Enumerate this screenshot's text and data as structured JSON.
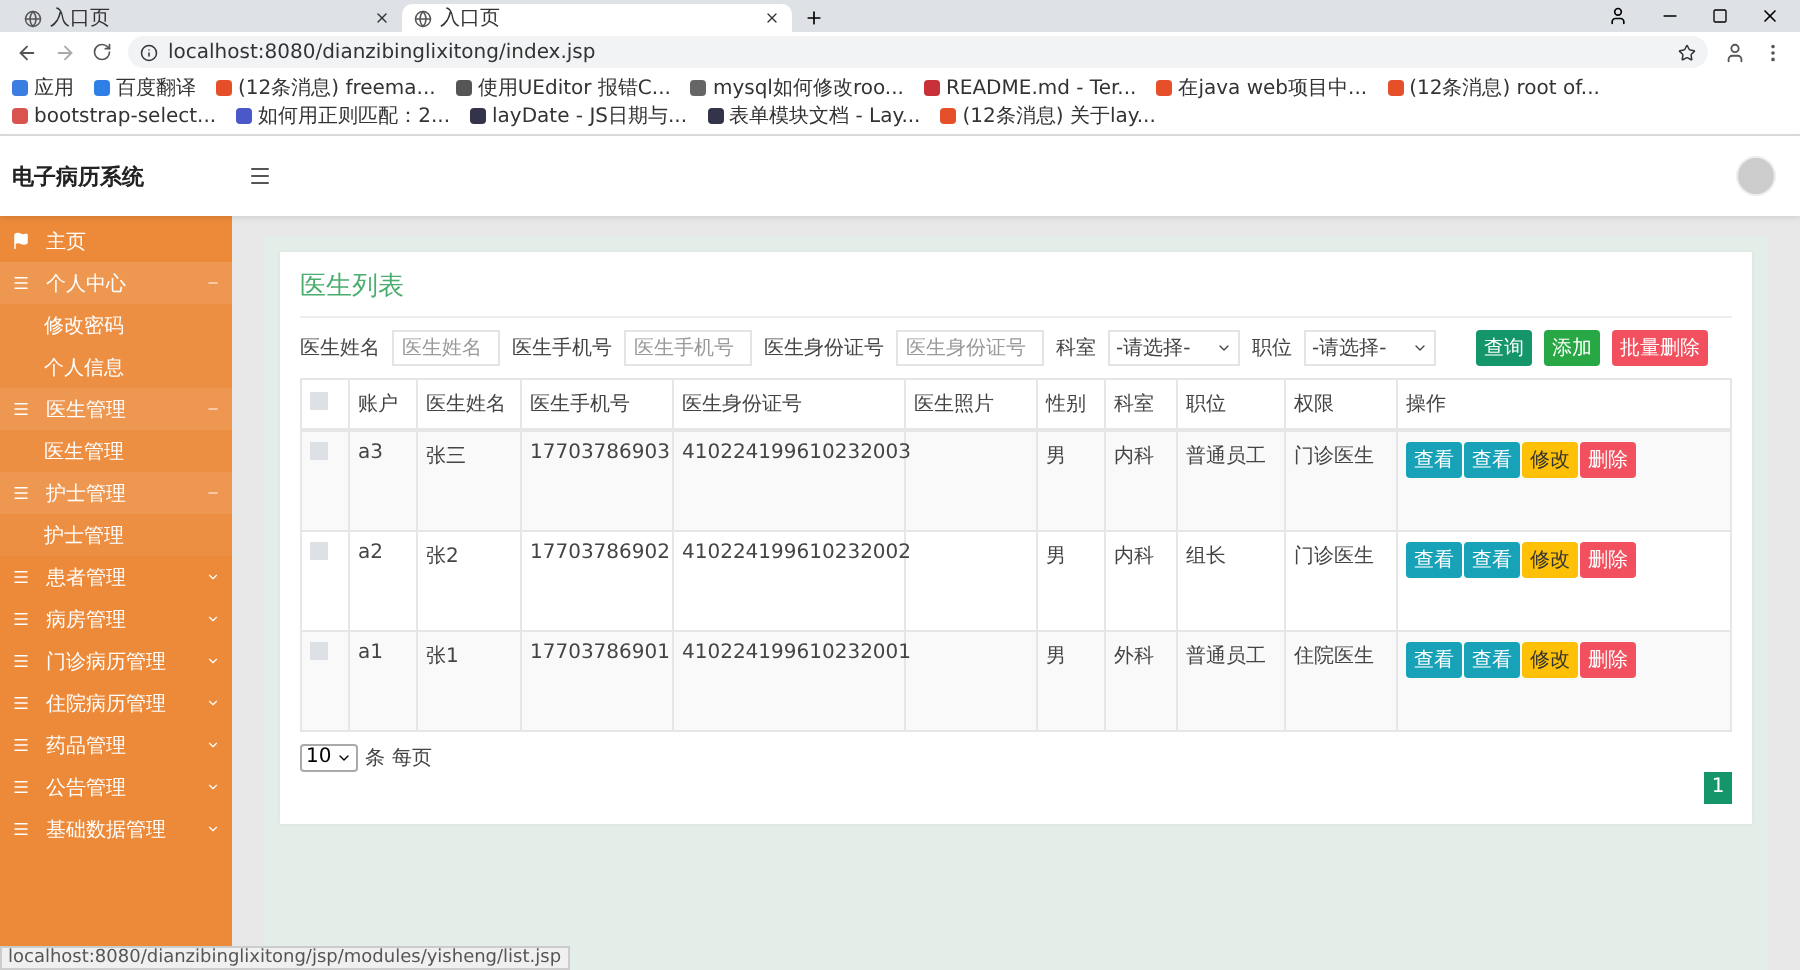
{
  "browser": {
    "tabs": [
      {
        "title": "入口页",
        "selected": false
      },
      {
        "title": "入口页",
        "selected": true
      }
    ],
    "address": "localhost:8080/dianzibinglixitong/index.jsp",
    "bookmarks": [
      {
        "label": "应用",
        "color": "#3b7de0"
      },
      {
        "label": "百度翻译",
        "color": "#2f7fe6"
      },
      {
        "label": "(12条消息) freema...",
        "color": "#e5502b"
      },
      {
        "label": "使用UEditor 报错C...",
        "color": "#555555"
      },
      {
        "label": "mysql如何修改roo...",
        "color": "#666666"
      },
      {
        "label": "README.md - Ter...",
        "color": "#c8303a"
      },
      {
        "label": "在java web项目中...",
        "color": "#e5502b"
      },
      {
        "label": "(12条消息) root of...",
        "color": "#e5502b"
      },
      {
        "label": "bootstrap-select...",
        "color": "#d9534f"
      },
      {
        "label": "如何用正则匹配：2...",
        "color": "#4a58c8"
      },
      {
        "label": "layDate - JS日期与...",
        "color": "#33334a"
      },
      {
        "label": "表单模块文档 - Lay...",
        "color": "#33334a"
      },
      {
        "label": "(12条消息) 关于lay...",
        "color": "#e5502b"
      }
    ],
    "status_url": "localhost:8080/dianzibinglixitong/jsp/modules/yisheng/list.jsp"
  },
  "app": {
    "title": "电子病历系统"
  },
  "sidebar": [
    {
      "label": "主页",
      "kind": "link"
    },
    {
      "label": "个人中心",
      "kind": "group",
      "expanded": true,
      "children": [
        {
          "label": "修改密码"
        },
        {
          "label": "个人信息"
        }
      ]
    },
    {
      "label": "医生管理",
      "kind": "group",
      "expanded": true,
      "children": [
        {
          "label": "医生管理"
        }
      ]
    },
    {
      "label": "护士管理",
      "kind": "group",
      "expanded": true,
      "children": [
        {
          "label": "护士管理"
        }
      ]
    },
    {
      "label": "患者管理",
      "kind": "group",
      "expanded": false
    },
    {
      "label": "病房管理",
      "kind": "group",
      "expanded": false
    },
    {
      "label": "门诊病历管理",
      "kind": "group",
      "expanded": false
    },
    {
      "label": "住院病历管理",
      "kind": "group",
      "expanded": false
    },
    {
      "label": "药品管理",
      "kind": "group",
      "expanded": false
    },
    {
      "label": "公告管理",
      "kind": "group",
      "expanded": false
    },
    {
      "label": "基础数据管理",
      "kind": "group",
      "expanded": false
    }
  ],
  "panel": {
    "title": "医生列表",
    "filters": [
      {
        "kind": "text",
        "label": "医生姓名",
        "placeholder": "医生姓名"
      },
      {
        "kind": "text",
        "label": "医生手机号",
        "placeholder": "医生手机号"
      },
      {
        "kind": "text",
        "label": "医生身份证号",
        "placeholder": "医生身份证号"
      },
      {
        "kind": "select",
        "label": "科室",
        "value": "-请选择-"
      },
      {
        "kind": "select",
        "label": "职位",
        "value": "-请选择-"
      }
    ],
    "buttons": [
      {
        "label": "查询",
        "kind": "query"
      },
      {
        "label": "添加",
        "kind": "add"
      },
      {
        "label": "批量删除",
        "kind": "delete"
      }
    ],
    "table": {
      "header_checked": false,
      "columns": [
        "账户",
        "医生姓名",
        "医生手机号",
        "医生身份证号",
        "医生照片",
        "性别",
        "科室",
        "职位",
        "权限",
        "操作"
      ],
      "rows": [
        {
          "checked": false,
          "cells": [
            "a3",
            "张三",
            "17703786903",
            "410224199610232003",
            "",
            "男",
            "内科",
            "普通员工",
            "门诊医生"
          ],
          "actions": [
            {
              "label": "查看",
              "kind": "view"
            },
            {
              "label": "查看",
              "kind": "view"
            },
            {
              "label": "修改",
              "kind": "edit"
            },
            {
              "label": "删除",
              "kind": "delete"
            }
          ]
        },
        {
          "checked": false,
          "cells": [
            "a2",
            "张2",
            "17703786902",
            "410224199610232002",
            "",
            "男",
            "内科",
            "组长",
            "门诊医生"
          ],
          "actions": [
            {
              "label": "查看",
              "kind": "view"
            },
            {
              "label": "查看",
              "kind": "view"
            },
            {
              "label": "修改",
              "kind": "edit"
            },
            {
              "label": "删除",
              "kind": "delete"
            }
          ]
        },
        {
          "checked": false,
          "cells": [
            "a1",
            "张1",
            "17703786901",
            "410224199610232001",
            "",
            "男",
            "外科",
            "普通员工",
            "住院医生"
          ],
          "actions": [
            {
              "label": "查看",
              "kind": "view"
            },
            {
              "label": "查看",
              "kind": "view"
            },
            {
              "label": "修改",
              "kind": "edit"
            },
            {
              "label": "删除",
              "kind": "delete"
            }
          ]
        }
      ]
    },
    "pagination": {
      "page_size": "10",
      "page_size_label": "条 每页",
      "pages": [
        {
          "label": "1",
          "selected": true
        }
      ]
    }
  }
}
